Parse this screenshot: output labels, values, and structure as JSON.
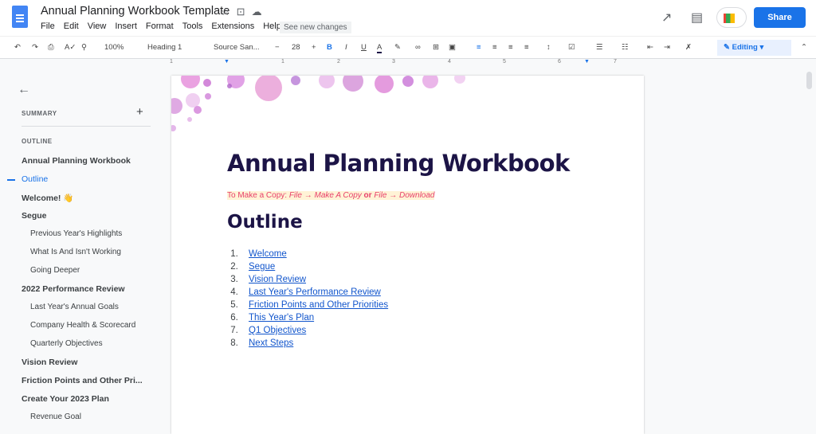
{
  "header": {
    "title": "Annual Planning Workbook Template",
    "menu": [
      "File",
      "Edit",
      "View",
      "Insert",
      "Format",
      "Tools",
      "Extensions",
      "Help"
    ],
    "see_new_changes": "See new changes",
    "share": "Share"
  },
  "toolbar": {
    "zoom": "100%",
    "style": "Heading 1",
    "font": "Source San...",
    "size": "28",
    "mode": "Editing"
  },
  "ruler": [
    "1",
    "1",
    "2",
    "3",
    "4",
    "5",
    "6",
    "7"
  ],
  "sidebar": {
    "summary": "SUMMARY",
    "outline": "OUTLINE",
    "items": [
      {
        "label": "Annual Planning Workbook",
        "level": 1
      },
      {
        "label": "Outline",
        "level": 1,
        "active": true
      },
      {
        "label": "Welcome! 👋",
        "level": 1
      },
      {
        "label": "Segue",
        "level": 1
      },
      {
        "label": "Previous Year's Highlights",
        "level": 2
      },
      {
        "label": "What Is And Isn't Working",
        "level": 2
      },
      {
        "label": "Going Deeper",
        "level": 2
      },
      {
        "label": "2022 Performance Review",
        "level": 1
      },
      {
        "label": "Last Year's Annual Goals",
        "level": 2
      },
      {
        "label": "Company Health & Scorecard",
        "level": 2
      },
      {
        "label": "Quarterly Objectives",
        "level": 2
      },
      {
        "label": "Vision Review",
        "level": 1
      },
      {
        "label": "Friction Points and Other Pri...",
        "level": 1
      },
      {
        "label": "Create Your 2023 Plan",
        "level": 1
      },
      {
        "label": "Revenue Goal",
        "level": 2
      }
    ]
  },
  "doc": {
    "title": "Annual Planning Workbook",
    "copy": {
      "prefix": "To Make a Copy: ",
      "a": "File → Make A Copy",
      "or": " or ",
      "b": "File → Download"
    },
    "heading": "Outline",
    "links": [
      "Welcome",
      "Segue",
      "Vision Review",
      "Last Year's Performance Review",
      "Friction Points and Other Priorities",
      "This Year's Plan",
      "Q1 Objectives",
      "Next Steps"
    ]
  },
  "colors": {
    "accent": "#1a73e8",
    "title": "#1c1446",
    "copy": "#e8406b"
  }
}
